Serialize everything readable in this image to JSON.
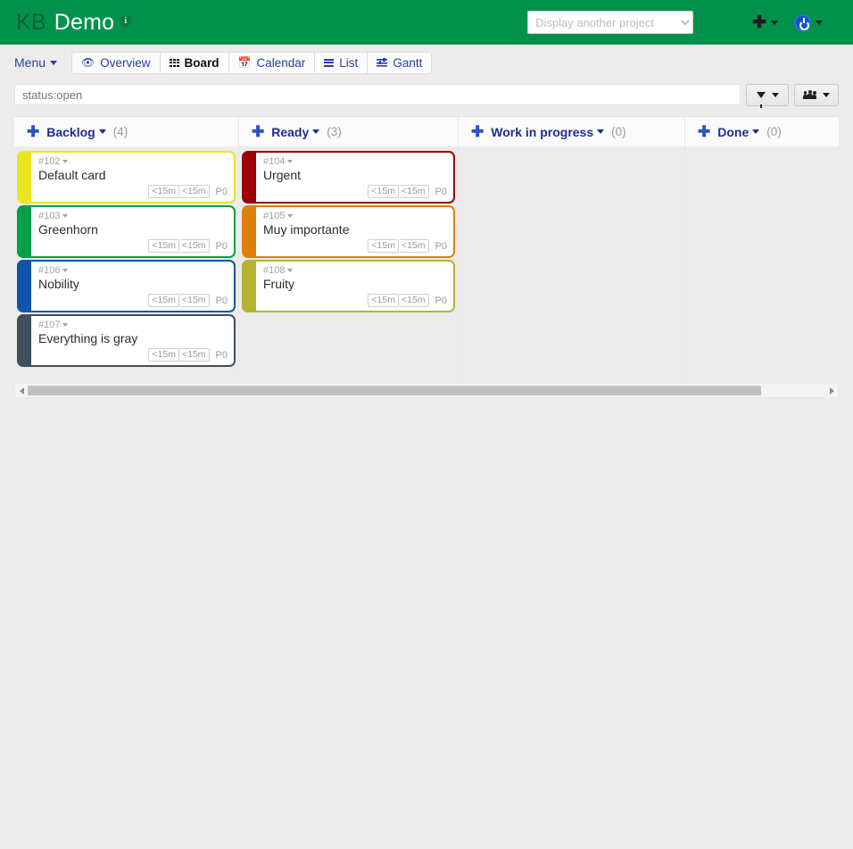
{
  "header": {
    "logo_prefix": "KB",
    "project_name": "Demo",
    "info_icon": "info-icon",
    "project_select_placeholder": "Display another project",
    "project_select_value": "Display another project",
    "add_icon": "plus-icon",
    "user_icon": "power-icon",
    "background_color": "#00924b"
  },
  "nav": {
    "menu_label": "Menu",
    "tabs": [
      {
        "label": "Overview",
        "icon": "eye-icon",
        "active": false
      },
      {
        "label": "Board",
        "icon": "grid-icon",
        "active": true
      },
      {
        "label": "Calendar",
        "icon": "calendar-icon",
        "active": false
      },
      {
        "label": "List",
        "icon": "list-icon",
        "active": false
      },
      {
        "label": "Gantt",
        "icon": "gantt-icon",
        "active": false
      }
    ]
  },
  "search": {
    "value": "status:open",
    "placeholder": "status:open",
    "filter_button_icon": "funnel-icon",
    "users_button_icon": "users-icon"
  },
  "board": {
    "columns": [
      {
        "title": "Backlog",
        "count": "(4)",
        "add_icon": "plus-icon",
        "tasks": [
          {
            "id": "#102",
            "title": "Default card",
            "time1": "<15m",
            "time2": "<15m",
            "priority": "P0",
            "color": "#eae51e"
          },
          {
            "id": "#103",
            "title": "Greenhorn",
            "time1": "<15m",
            "time2": "<15m",
            "priority": "P0",
            "color": "#00a04a"
          },
          {
            "id": "#106",
            "title": "Nobility",
            "time1": "<15m",
            "time2": "<15m",
            "priority": "P0",
            "color": "#1054a8"
          },
          {
            "id": "#107",
            "title": "Everything is gray",
            "time1": "<15m",
            "time2": "<15m",
            "priority": "P0",
            "color": "#3f4f5c"
          }
        ]
      },
      {
        "title": "Ready",
        "count": "(3)",
        "add_icon": "plus-icon",
        "tasks": [
          {
            "id": "#104",
            "title": "Urgent",
            "time1": "<15m",
            "time2": "<15m",
            "priority": "P0",
            "color": "#9c0000"
          },
          {
            "id": "#105",
            "title": "Muy importante",
            "time1": "<15m",
            "time2": "<15m",
            "priority": "P0",
            "color": "#dd8009"
          },
          {
            "id": "#108",
            "title": "Fruity",
            "time1": "<15m",
            "time2": "<15m",
            "priority": "P0",
            "color": "#b5b335"
          }
        ]
      },
      {
        "title": "Work in progress",
        "count": "(0)",
        "add_icon": "plus-icon",
        "tasks": []
      },
      {
        "title": "Done",
        "count": "(0)",
        "add_icon": "plus-icon",
        "tasks": []
      }
    ]
  },
  "scrollbar": {
    "left_arrow": "scroll-left-icon",
    "right_arrow": "scroll-right-icon",
    "thumb_percent": 92
  }
}
